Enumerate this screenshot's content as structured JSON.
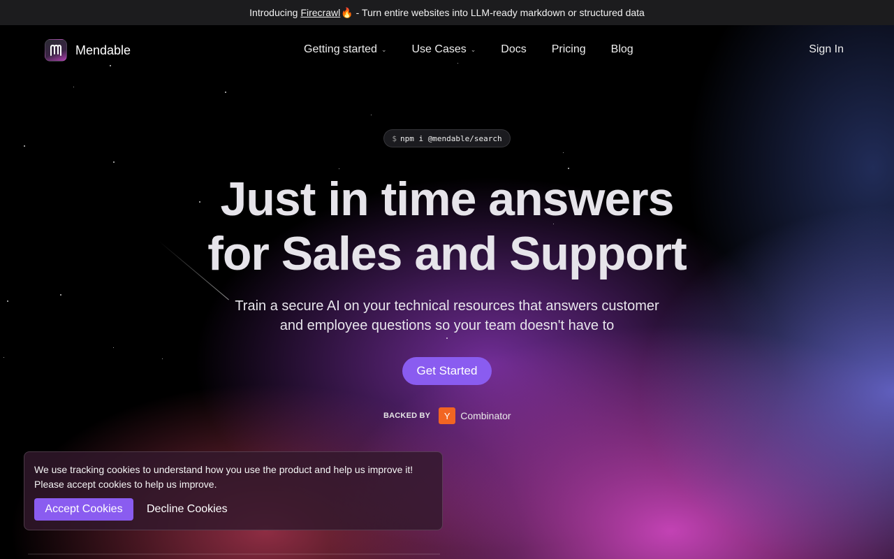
{
  "banner": {
    "prefix": "Introducing",
    "link": "Firecrawl",
    "emoji": "🔥",
    "suffix": "- Turn entire websites into LLM-ready markdown or structured data"
  },
  "nav": {
    "brand": "Mendable",
    "items": [
      {
        "label": "Getting started",
        "has_dropdown": true
      },
      {
        "label": "Use Cases",
        "has_dropdown": true
      },
      {
        "label": "Docs",
        "has_dropdown": false
      },
      {
        "label": "Pricing",
        "has_dropdown": false
      },
      {
        "label": "Blog",
        "has_dropdown": false
      }
    ],
    "sign_in": "Sign In"
  },
  "hero": {
    "install_prompt": "$",
    "install_command": "npm i @mendable/search",
    "headline_line1": "Just in time answers",
    "headline_line2": "for Sales and Support",
    "subtitle_line1": "Train a secure AI on your technical resources that answers customer",
    "subtitle_line2": "and employee questions so your team doesn't have to",
    "cta": "Get Started",
    "backed_by": "BACKED BY",
    "yc_letter": "Y",
    "yc_name": "Combinator"
  },
  "cookie_banner": {
    "line1": "We use tracking cookies to understand how you use the product and help us improve it!",
    "line2": "Please accept cookies to help us improve.",
    "accept": "Accept Cookies",
    "decline": "Decline Cookies"
  },
  "colors": {
    "accent": "#8a5cf0",
    "yc_orange": "#f26522",
    "banner_bg": "#1c1c1e"
  }
}
